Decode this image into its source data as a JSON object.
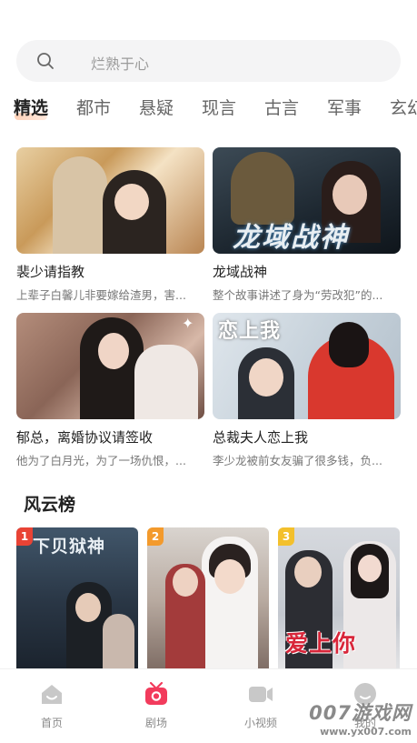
{
  "search": {
    "placeholder": "烂熟于心"
  },
  "tabs": [
    {
      "label": "精选",
      "active": true
    },
    {
      "label": "都市"
    },
    {
      "label": "悬疑"
    },
    {
      "label": "现言"
    },
    {
      "label": "古言"
    },
    {
      "label": "军事"
    },
    {
      "label": "玄幻"
    }
  ],
  "cards": [
    {
      "title": "裴少请指教",
      "desc": "上辈子白馨儿非要嫁给渣男，害..."
    },
    {
      "title": "龙域战神",
      "desc": "整个故事讲述了身为“劳改犯”的...",
      "poster_text": "龙域战神"
    },
    {
      "title": "郁总，离婚协议请签收",
      "desc": "他为了白月光，为了一场仇恨，..."
    },
    {
      "title": "总裁夫人恋上我",
      "desc": "李少龙被前女友骗了很多钱，负...",
      "poster_text": "恋上我"
    }
  ],
  "ranking": {
    "title": "风云榜",
    "items": [
      {
        "rank": "1",
        "poster_text": "下贝狱神"
      },
      {
        "rank": "2"
      },
      {
        "rank": "3",
        "poster_text": "爱上你"
      }
    ]
  },
  "nav": [
    {
      "label": "首页",
      "icon": "home-icon"
    },
    {
      "label": "剧场",
      "icon": "theater-icon",
      "active": true
    },
    {
      "label": "小视频",
      "icon": "video-icon"
    },
    {
      "label": "我的",
      "icon": "profile-icon"
    }
  ],
  "watermark": {
    "main": "007游戏网",
    "url": "www.yx007.com"
  },
  "colors": {
    "accent": "#f23b5c",
    "rank1": "#e94335",
    "rank2": "#f39a2c",
    "rank3": "#f3c02c"
  }
}
